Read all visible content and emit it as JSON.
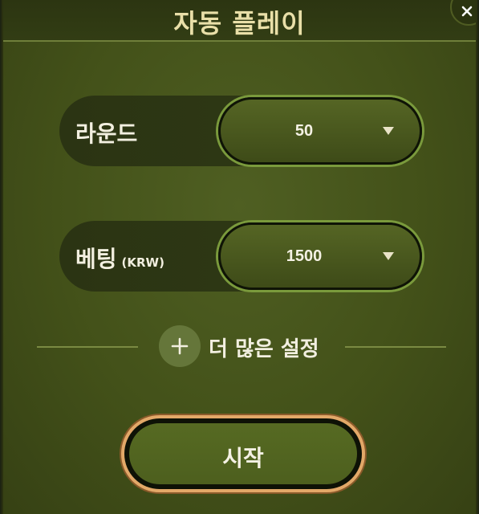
{
  "dialog": {
    "title": "자동 플레이",
    "close_icon": "close-icon"
  },
  "rounds": {
    "label": "라운드",
    "selected": "50"
  },
  "bet": {
    "label": "베팅",
    "unit": "(KRW)",
    "selected": "1500"
  },
  "more_settings": {
    "label": "더 많은 설정",
    "icon": "plus-icon"
  },
  "start": {
    "label": "시작"
  },
  "colors": {
    "title": "#e9dfa8",
    "panel": "#435119",
    "select_border": "#7a9a3c",
    "start_border": "#e2a868"
  }
}
